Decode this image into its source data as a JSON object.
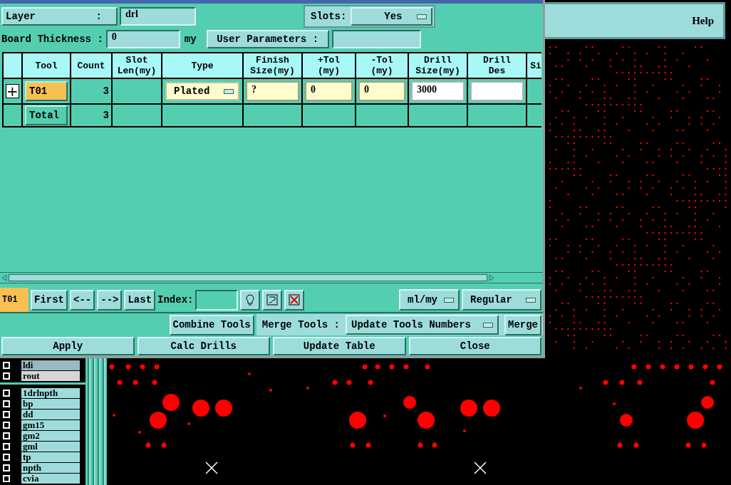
{
  "help": "Help",
  "dialog": {
    "layer": {
      "label": "Layer",
      "colon": ":",
      "value": "drl"
    },
    "slots": {
      "label": "Slots:",
      "value": "Yes"
    },
    "board_thickness": {
      "label": "Board Thickness :",
      "value": "0",
      "unit": "my"
    },
    "user_parameters": {
      "label": "User Parameters :"
    },
    "table": {
      "columns": [
        {
          "lines": [
            "Tool"
          ]
        },
        {
          "lines": [
            "Count"
          ]
        },
        {
          "lines": [
            "Slot",
            "Len(my)"
          ]
        },
        {
          "lines": [
            "Type"
          ]
        },
        {
          "lines": [
            "Finish",
            "Size(my)"
          ]
        },
        {
          "lines": [
            "+Tol",
            "(my)"
          ]
        },
        {
          "lines": [
            "-Tol",
            "(my)"
          ]
        },
        {
          "lines": [
            "Drill",
            "Size(my)"
          ]
        },
        {
          "lines": [
            "Drill",
            "Des"
          ]
        },
        {
          "lines": [
            "Si"
          ]
        }
      ],
      "rows": [
        {
          "expand": "+",
          "tool": "T01",
          "selected": true,
          "count": "3",
          "type": "Plated",
          "finish_size": "?",
          "plus_tol": "0",
          "minus_tol": "0",
          "drill_size": "3000"
        }
      ],
      "total": {
        "label": "Total",
        "count": "3"
      }
    },
    "nav": {
      "current": "T01",
      "buttons": [
        "First",
        "<--",
        "-->",
        "Last"
      ],
      "index_label": "Index:",
      "units": "ml/my",
      "mode": "Regular"
    },
    "merge": {
      "combine": "Combine Tools",
      "label": "Merge Tools :",
      "option": "Update Tools Numbers",
      "button": "Merge"
    },
    "actions": [
      "Apply",
      "Calc Drills",
      "Update Table",
      "Close"
    ]
  },
  "layer_groups": [
    {
      "items": [
        {
          "name": "ldi",
          "selected": true,
          "checked": false
        },
        {
          "name": "rout",
          "selected": false,
          "checked": false
        }
      ]
    },
    {
      "items": [
        {
          "name": "1drlnpth",
          "selected": false,
          "checked": false
        },
        {
          "name": "bp",
          "selected": false,
          "checked": false
        },
        {
          "name": "dd",
          "selected": false,
          "checked": false
        },
        {
          "name": "gm15",
          "selected": false,
          "checked": false
        },
        {
          "name": "gm2",
          "selected": false,
          "checked": false
        },
        {
          "name": "gml",
          "selected": false,
          "checked": false
        },
        {
          "name": "tp",
          "selected": false,
          "checked": false
        },
        {
          "name": "npth",
          "selected": false,
          "checked": false
        },
        {
          "name": "cvia",
          "selected": false,
          "checked": false
        }
      ]
    }
  ]
}
